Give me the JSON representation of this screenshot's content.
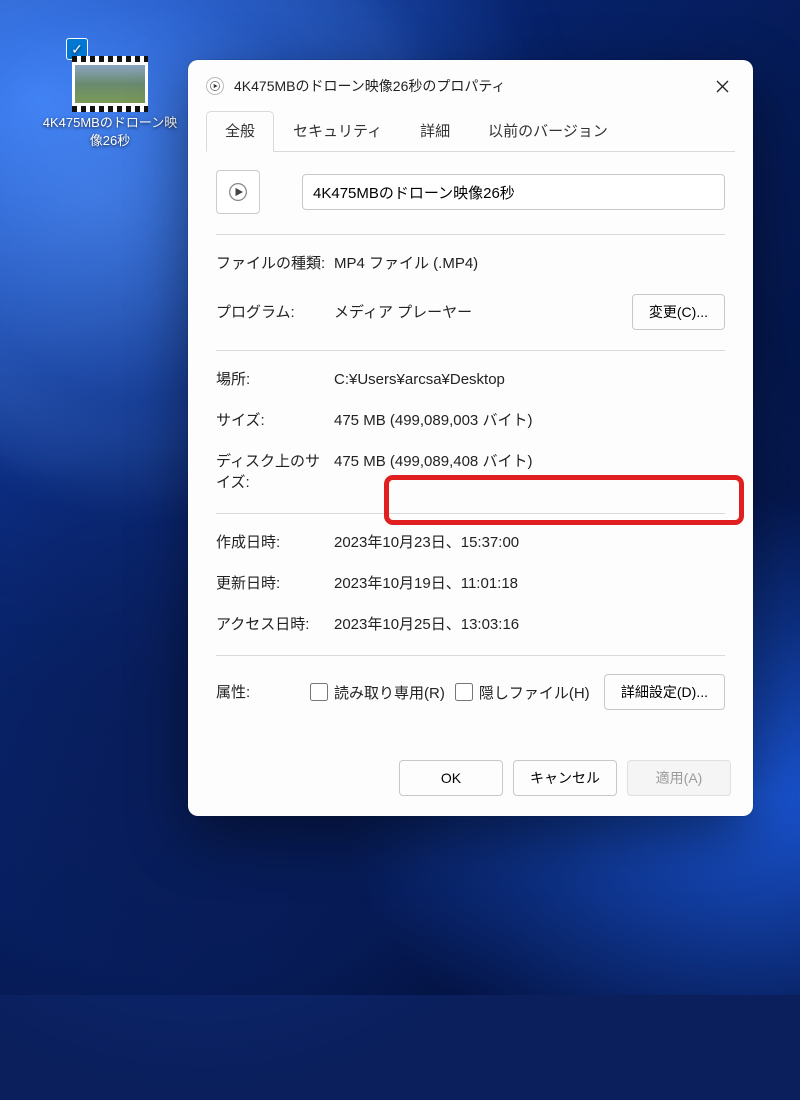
{
  "desktop": {
    "icon_label": "4K475MBのドローン映像26秒"
  },
  "dialog": {
    "title": "4K475MBのドローン映像26秒のプロパティ",
    "tabs": {
      "general": "全般",
      "security": "セキュリティ",
      "details": "詳細",
      "previous": "以前のバージョン"
    },
    "filename": "4K475MBのドローン映像26秒",
    "rows": {
      "filetype_label": "ファイルの種類:",
      "filetype_value": "MP4 ファイル (.MP4)",
      "program_label": "プログラム:",
      "program_value": "メディア プレーヤー",
      "change_btn": "変更(C)...",
      "location_label": "場所:",
      "location_value": "C:¥Users¥arcsa¥Desktop",
      "size_label": "サイズ:",
      "size_value": "475 MB (499,089,003 バイト)",
      "disksize_label": "ディスク上のサイズ:",
      "disksize_value": "475 MB (499,089,408 バイト)",
      "created_label": "作成日時:",
      "created_value": "2023年10月23日、15:37:00",
      "modified_label": "更新日時:",
      "modified_value": "2023年10月19日、11:01:18",
      "accessed_label": "アクセス日時:",
      "accessed_value": "2023年10月25日、13:03:16",
      "attrs_label": "属性:",
      "readonly_label": "読み取り専用(R)",
      "hidden_label": "隠しファイル(H)",
      "advanced_btn": "詳細設定(D)..."
    },
    "footer": {
      "ok": "OK",
      "cancel": "キャンセル",
      "apply": "適用(A)"
    }
  }
}
